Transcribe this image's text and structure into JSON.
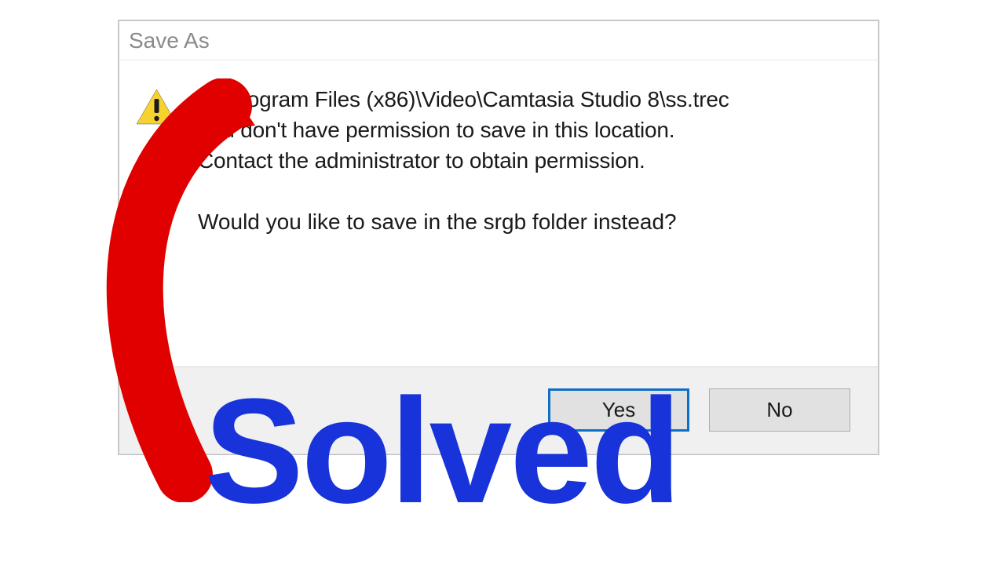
{
  "dialog": {
    "title": "Save As",
    "message": {
      "path": "C:\\Program Files (x86)\\Video\\Camtasia Studio 8\\ss.trec",
      "line2": "You don't have permission to save in this location.",
      "line3": "Contact the administrator to obtain permission.",
      "question": "Would you like to save in the srgb folder instead?"
    },
    "buttons": {
      "yes": "Yes",
      "no": "No"
    }
  },
  "overlay": {
    "text": "Solved"
  },
  "colors": {
    "arrow": "#e00000",
    "overlay_text": "#1733d9",
    "default_button_border": "#0e6fc7"
  }
}
